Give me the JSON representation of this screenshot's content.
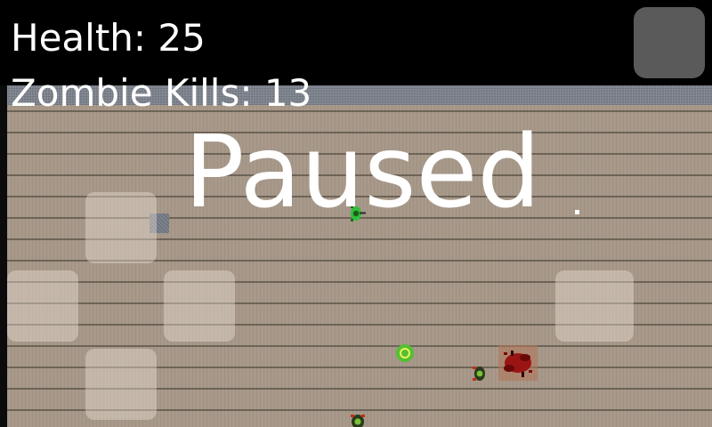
{
  "hud": {
    "health_label": "Health: 25",
    "kills_label": "Zombie Kills: 13",
    "health_value": 25,
    "zombie_kills_value": 13
  },
  "overlay": {
    "paused_label": "Paused"
  },
  "controls": {
    "pause_button_icon": "blank-square",
    "dpad": [
      "up",
      "left",
      "right",
      "down"
    ],
    "fire_button_icon": "blank-square"
  },
  "colors": {
    "floor": "#a8998a",
    "floor_plank_line": "#6f6558",
    "wall_top": "#7c828c",
    "hud_text": "#ffffff",
    "pause_button": "#5a5a5a",
    "control_overlay": "rgba(240,230,220,0.40)",
    "player": "#2fbf3a",
    "zombie": "#2a3a1a",
    "pickup": "#52c130",
    "blood": "#9a1414"
  },
  "sprites": {
    "player": "player-icon",
    "zombies": [
      "zombie-icon",
      "zombie-icon"
    ],
    "pickup": "health-pickup-icon",
    "blood": "blood-splatter-icon"
  }
}
